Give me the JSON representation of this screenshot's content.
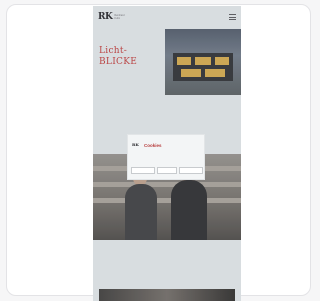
{
  "header": {
    "logo": "RK",
    "logo_sub": "Reinhard Kuhn"
  },
  "hero": {
    "eyebrow": "",
    "title_line1": "Licht-",
    "title_line2": "BLICKE",
    "lead": "",
    "intro": ""
  },
  "section": {
    "heading": "",
    "text": "",
    "link": ""
  },
  "cookie": {
    "logo": "RK",
    "title": "Cookies",
    "text": "",
    "buttons": [
      "",
      "",
      ""
    ],
    "link": ""
  },
  "colors": {
    "accent": "#b63a3a",
    "page_bg": "#d6dbdf",
    "modal_bg": "#f3f5f6"
  }
}
